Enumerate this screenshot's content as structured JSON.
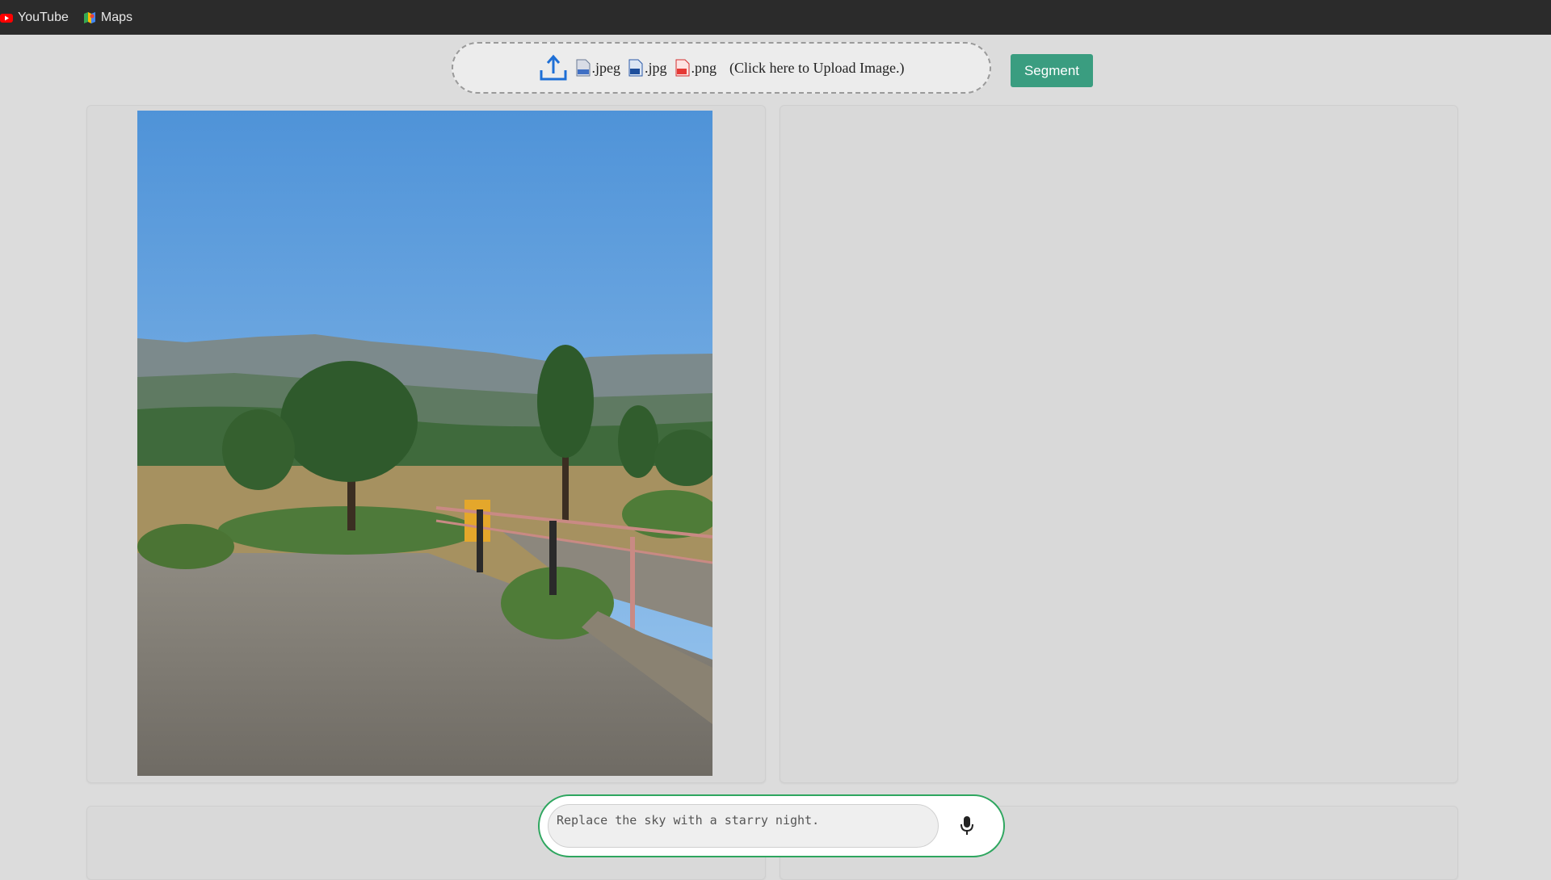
{
  "bookmarks": [
    {
      "label": "YouTube",
      "icon": "youtube-icon"
    },
    {
      "label": "Maps",
      "icon": "maps-icon"
    }
  ],
  "upload": {
    "formats": [
      ".jpeg",
      ".jpg",
      ".png"
    ],
    "hint": "(Click here to Upload Image.)"
  },
  "segment_button": "Segment",
  "prompt": {
    "placeholder": "Replace the sky with a starry night."
  },
  "colors": {
    "accent_button": "#3a9d80",
    "prompt_border": "#2ea65f",
    "bookmarks_bar": "#2b2b2b"
  }
}
